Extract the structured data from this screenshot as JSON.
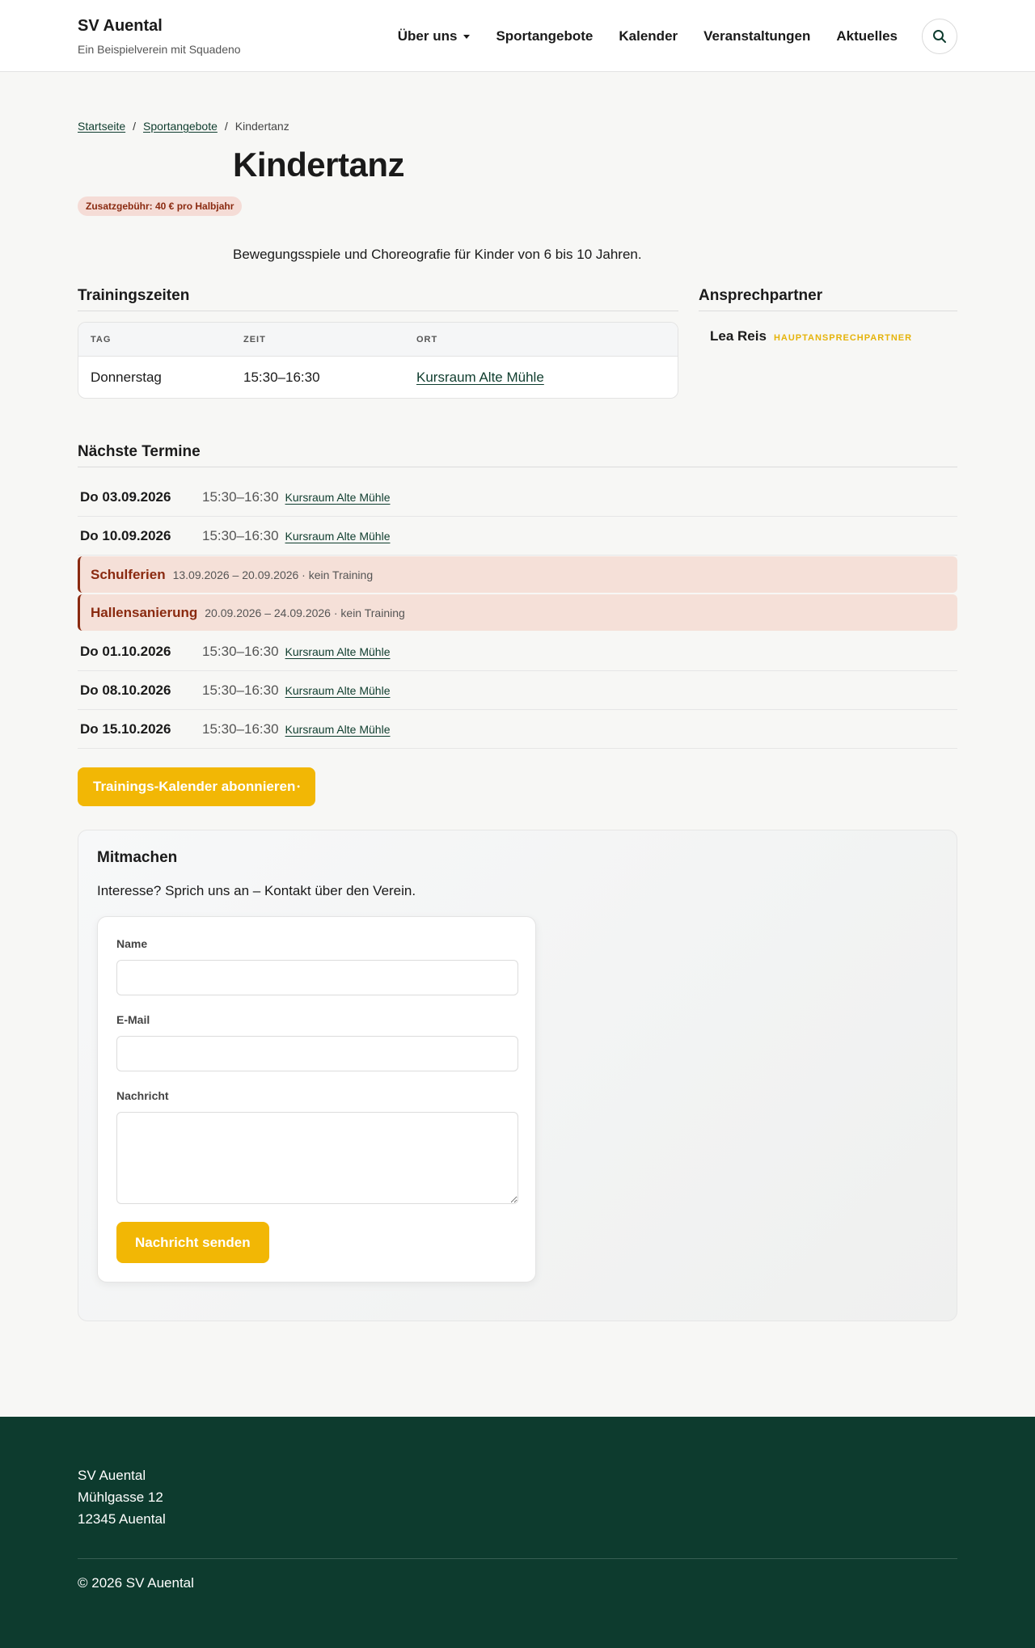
{
  "site": {
    "name": "SV Auental",
    "tagline": "Ein Beispielverein mit Squadeno"
  },
  "nav": {
    "items": [
      {
        "label": "Über uns",
        "dropdown": true
      },
      {
        "label": "Sportangebote"
      },
      {
        "label": "Kalender"
      },
      {
        "label": "Veranstaltungen"
      },
      {
        "label": "Aktuelles"
      }
    ],
    "search_icon": "search-icon"
  },
  "breadcrumb": {
    "items": [
      "Startseite",
      "Sportangebote"
    ],
    "current": "Kindertanz",
    "separator": "/"
  },
  "page": {
    "title": "Kindertanz",
    "fee_badge": "Zusatzgebühr: 40 € pro Halbjahr",
    "intro": "Bewegungsspiele und Choreografie für Kinder von 6 bis 10 Jahren."
  },
  "training": {
    "title": "Trainingszeiten",
    "headers": [
      "TAG",
      "ZEIT",
      "ORT"
    ],
    "rows": [
      {
        "day": "Donnerstag",
        "time": "15:30–16:30",
        "place": "Kursraum Alte Mühle"
      }
    ]
  },
  "contact": {
    "title": "Ansprechpartner",
    "name": "Lea Reis",
    "role": "HAUPTANSPRECHPARTNER"
  },
  "dates": {
    "title": "Nächste Termine",
    "entries": [
      {
        "day": "Do 03.09.2026",
        "time": "15:30–16:30",
        "place": "Kursraum Alte Mühle"
      },
      {
        "day": "Do 10.09.2026",
        "time": "15:30–16:30",
        "place": "Kursraum Alte Mühle"
      }
    ],
    "breaks": [
      {
        "title": "Schulferien",
        "info": "13.09.2026 – 20.09.2026 · kein Training"
      },
      {
        "title": "Hallensanierung",
        "info": "20.09.2026 – 24.09.2026 · kein Training"
      }
    ],
    "entries_after": [
      {
        "day": "Do 01.10.2026",
        "time": "15:30–16:30",
        "place": "Kursraum Alte Mühle"
      },
      {
        "day": "Do 08.10.2026",
        "time": "15:30–16:30",
        "place": "Kursraum Alte Mühle"
      },
      {
        "day": "Do 15.10.2026",
        "time": "15:30–16:30",
        "place": "Kursraum Alte Mühle"
      }
    ],
    "subscribe_label": "Trainings-Kalender abonnieren",
    "subscribe_icon": "•"
  },
  "join": {
    "title": "Mitmachen",
    "text": "Interesse? Sprich uns an – Kontakt über den Verein.",
    "name_label": "Name",
    "email_label": "E-Mail",
    "message_label": "Nachricht",
    "submit_label": "Nachricht senden"
  },
  "footer": {
    "address": [
      "SV Auental",
      "Mühlgasse 12",
      "12345 Auental"
    ],
    "copyright": "© 2026 SV Auental"
  },
  "colors": {
    "brand_dark": "#0d3b2e",
    "accent": "#f2b705",
    "alert_text": "#8a2a10",
    "alert_bg": "#f5e0d8"
  }
}
